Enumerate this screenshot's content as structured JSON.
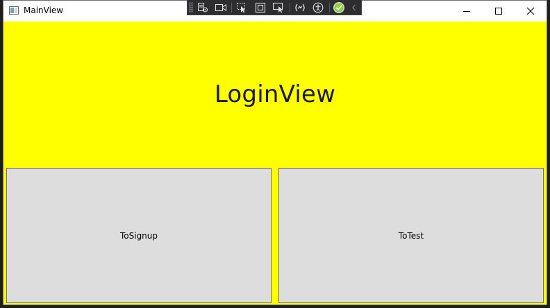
{
  "window": {
    "title": "MainView",
    "controls": {
      "minimize_icon": "minimize-icon",
      "maximize_icon": "maximize-icon",
      "close_icon": "close-icon"
    }
  },
  "debug_toolbar": {
    "icons": [
      "live-visual-tree-icon",
      "record-icon",
      "select-element-icon",
      "display-layout-adorners-icon",
      "track-focus-icon",
      "binding-failures-icon",
      "accessibility-icon",
      "hot-reload-ok-icon",
      "collapse-chevron-icon"
    ]
  },
  "main": {
    "heading": "LoginView",
    "buttons": {
      "signup_label": "ToSignup",
      "test_label": "ToTest"
    }
  },
  "colors": {
    "content_background": "#ffff00",
    "button_background": "#dddddd",
    "debug_toolbar": "#2d2d30",
    "hot_reload_ok": "#8fce3c"
  }
}
